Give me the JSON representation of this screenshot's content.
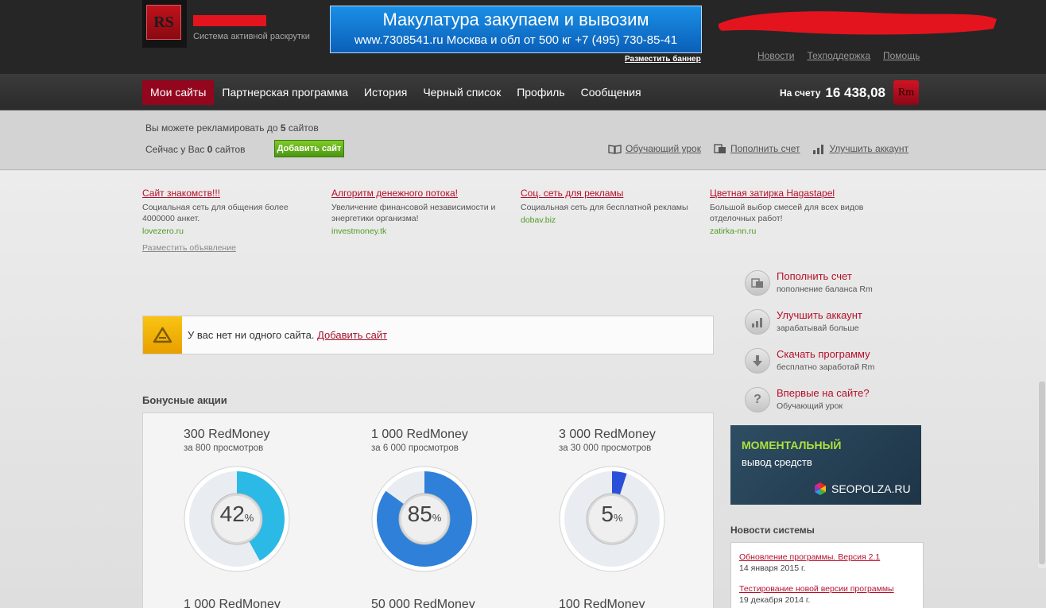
{
  "header": {
    "logo_text": "RS",
    "tagline": "Система активной раскрутки",
    "banner": {
      "line1": "Макулатура закупаем и вывозим",
      "line2": "www.7308541.ru  Москва и обл от 500 кг  +7 (495) 730-85-41",
      "place_link": "Разместить баннер"
    },
    "links": [
      "Новости",
      "Техподдержка",
      "Помощь"
    ]
  },
  "nav": {
    "items": [
      {
        "label": "Мои сайты",
        "active": true
      },
      {
        "label": "Партнерская программа",
        "active": false
      },
      {
        "label": "История",
        "active": false
      },
      {
        "label": "Черный список",
        "active": false
      },
      {
        "label": "Профиль",
        "active": false
      },
      {
        "label": "Сообщения",
        "active": false
      }
    ],
    "balance_label": "На счету",
    "balance_value": "16 438,08",
    "currency": "Rm"
  },
  "info": {
    "line1_prefix": "Вы можете рекламировать до",
    "line1_num": "5",
    "line1_suffix": "сайтов",
    "line2_prefix": "Сейчас у Вас",
    "line2_num": "0",
    "line2_suffix": "сайтов",
    "add_button": "Добавить сайт",
    "links": [
      {
        "icon": "book-icon",
        "label": "Обучающий урок"
      },
      {
        "icon": "money-icon",
        "label": "Пополнить счет"
      },
      {
        "icon": "chart-icon",
        "label": "Улучшить аккаунт"
      }
    ]
  },
  "ads": [
    {
      "title": "Сайт знакомств!!!",
      "desc": "Социальная сеть для общения более 4000000 анкет.",
      "url": "lovezero.ru"
    },
    {
      "title": "Алгоритм денежного потока!",
      "desc": "Увеличение финансовой независимости и энергетики организма!",
      "url": "investmoney.tk"
    },
    {
      "title": "Соц. сеть для рекламы",
      "desc": "Социальная сеть для бесплатной рекламы",
      "url": "dobav.biz"
    },
    {
      "title": "Цветная затирка Hagastapel",
      "desc": "Большой выбор смесей для всех видов отделочных работ!",
      "url": "zatirka-nn.ru"
    }
  ],
  "place_ad": "Разместить объявление",
  "alert": {
    "text": "У вас нет ни одного сайта.",
    "link": "Добавить сайт"
  },
  "bonus": {
    "title": "Бонусные акции",
    "items": [
      {
        "amount": "300 RedMoney",
        "desc": "за 800 просмотров",
        "percent": 42,
        "color": "#2bb9e6"
      },
      {
        "amount": "1 000 RedMoney",
        "desc": "за 6 000 просмотров",
        "percent": 85,
        "color": "#2f80d8"
      },
      {
        "amount": "3 000 RedMoney",
        "desc": "за 30 000 просмотров",
        "percent": 5,
        "color": "#2a4fd8"
      }
    ],
    "row2": [
      "1 000 RedMoney",
      "50 000 RedMoney",
      "100 RedMoney"
    ]
  },
  "sidebar": [
    {
      "icon": "money-icon",
      "title": "Пополнить счет",
      "sub": "пополнение баланса Rm"
    },
    {
      "icon": "chart-icon",
      "title": "Улучшить аккаунт",
      "sub": "зарабатывай больше"
    },
    {
      "icon": "download-icon",
      "title": "Скачать программу",
      "sub": "бесплатно заработай Rm"
    },
    {
      "icon": "question-icon",
      "title": "Впервые на сайте?",
      "sub": "Обучающий урок"
    }
  ],
  "promo": {
    "line1": "МОМЕНТАЛЬНЫЙ",
    "line2": "вывод средств",
    "brand": "SEOPOLZA.RU"
  },
  "news": {
    "title": "Новости системы",
    "items": [
      {
        "title": "Обновление программы. Версия 2.1",
        "date": "14 января 2015 г."
      },
      {
        "title": "Тестирование новой версии программы",
        "date": "19 декабря 2014 г."
      }
    ]
  }
}
